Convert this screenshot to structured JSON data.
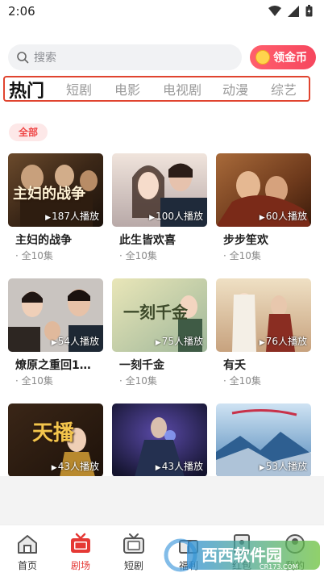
{
  "status": {
    "time": "2:06"
  },
  "search": {
    "placeholder": "搜索"
  },
  "coin_button": {
    "label": "领金币"
  },
  "tabs": [
    {
      "label": "热门",
      "active": true
    },
    {
      "label": "短剧"
    },
    {
      "label": "电影"
    },
    {
      "label": "电视剧"
    },
    {
      "label": "动漫"
    },
    {
      "label": "综艺"
    }
  ],
  "filter": {
    "label": "全部"
  },
  "cards": [
    {
      "title": "主妇的战争",
      "poster_text": "主妇的战争",
      "plays": "187人播放",
      "episodes": "· 全10集"
    },
    {
      "title": "此生皆欢喜",
      "poster_text": "",
      "plays": "100人播放",
      "episodes": "· 全10集"
    },
    {
      "title": "步步笙欢",
      "poster_text": "",
      "plays": "60人播放",
      "episodes": "· 全10集"
    },
    {
      "title": "燎原之重回1…",
      "poster_text": "",
      "plays": "54人播放",
      "episodes": "· 全10集"
    },
    {
      "title": "一刻千金",
      "poster_text": "一刻千金",
      "plays": "75人播放",
      "episodes": "· 全10集"
    },
    {
      "title": "有夭",
      "poster_text": "",
      "plays": "76人播放",
      "episodes": "· 全10集"
    },
    {
      "title": "",
      "poster_text": "天播",
      "plays": "43人播放",
      "episodes": ""
    },
    {
      "title": "",
      "poster_text": "",
      "plays": "43人播放",
      "episodes": ""
    },
    {
      "title": "",
      "poster_text": "",
      "plays": "53人播放",
      "episodes": ""
    }
  ],
  "bottom_nav": [
    {
      "label": "首页",
      "icon": "home-icon"
    },
    {
      "label": "剧场",
      "icon": "theater-icon",
      "active": true
    },
    {
      "label": "短剧",
      "icon": "tv-icon"
    },
    {
      "label": "福利",
      "icon": "gift-icon"
    },
    {
      "label": "红包",
      "icon": "red-packet-icon"
    },
    {
      "label": "我的",
      "icon": "profile-icon"
    }
  ],
  "watermark": {
    "text": "西西软件园",
    "sub": "CR173.COM"
  },
  "colors": {
    "accent": "#e53935",
    "tab_border": "#e0442f",
    "coin_gradient_start": "#ff5f6d"
  }
}
